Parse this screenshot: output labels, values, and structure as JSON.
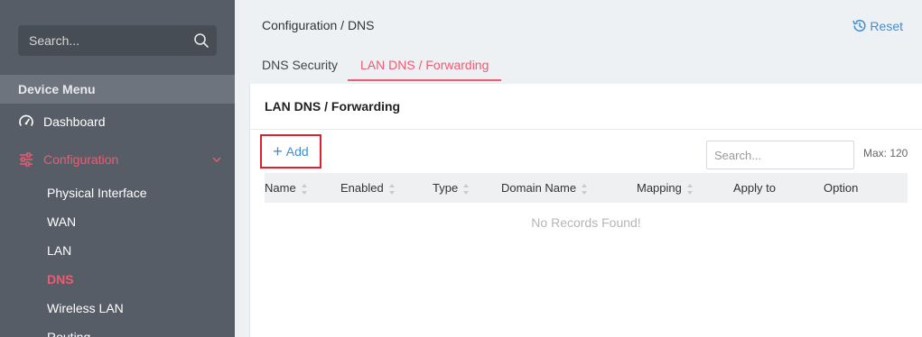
{
  "sidebar": {
    "search_placeholder": "Search...",
    "menu_header": "Device Menu",
    "items": [
      {
        "label": "Dashboard",
        "icon": "gauge-icon"
      },
      {
        "label": "Configuration",
        "icon": "sliders-icon",
        "expanded": true
      }
    ],
    "sub_items": [
      "Physical Interface",
      "WAN",
      "LAN",
      "DNS",
      "Wireless LAN",
      "Routing"
    ],
    "active_sub_item": "DNS"
  },
  "header": {
    "breadcrumb": "Configuration / DNS",
    "reset_label": "Reset"
  },
  "tabs": [
    {
      "label": "DNS Security",
      "active": false
    },
    {
      "label": "LAN DNS / Forwarding",
      "active": true
    }
  ],
  "panel": {
    "title": "LAN DNS / Forwarding",
    "add_label": "Add",
    "search_placeholder": "Search...",
    "max_label": "Max: 120",
    "columns": [
      "Name",
      "Enabled",
      "Type",
      "Domain Name",
      "Mapping",
      "Apply to",
      "Option"
    ],
    "empty_message": "No Records Found!"
  },
  "colors": {
    "accent": "#ef5b72",
    "link": "#3a8fd8",
    "sidebar_bg": "#565d66",
    "highlight_border": "#e0202e"
  }
}
